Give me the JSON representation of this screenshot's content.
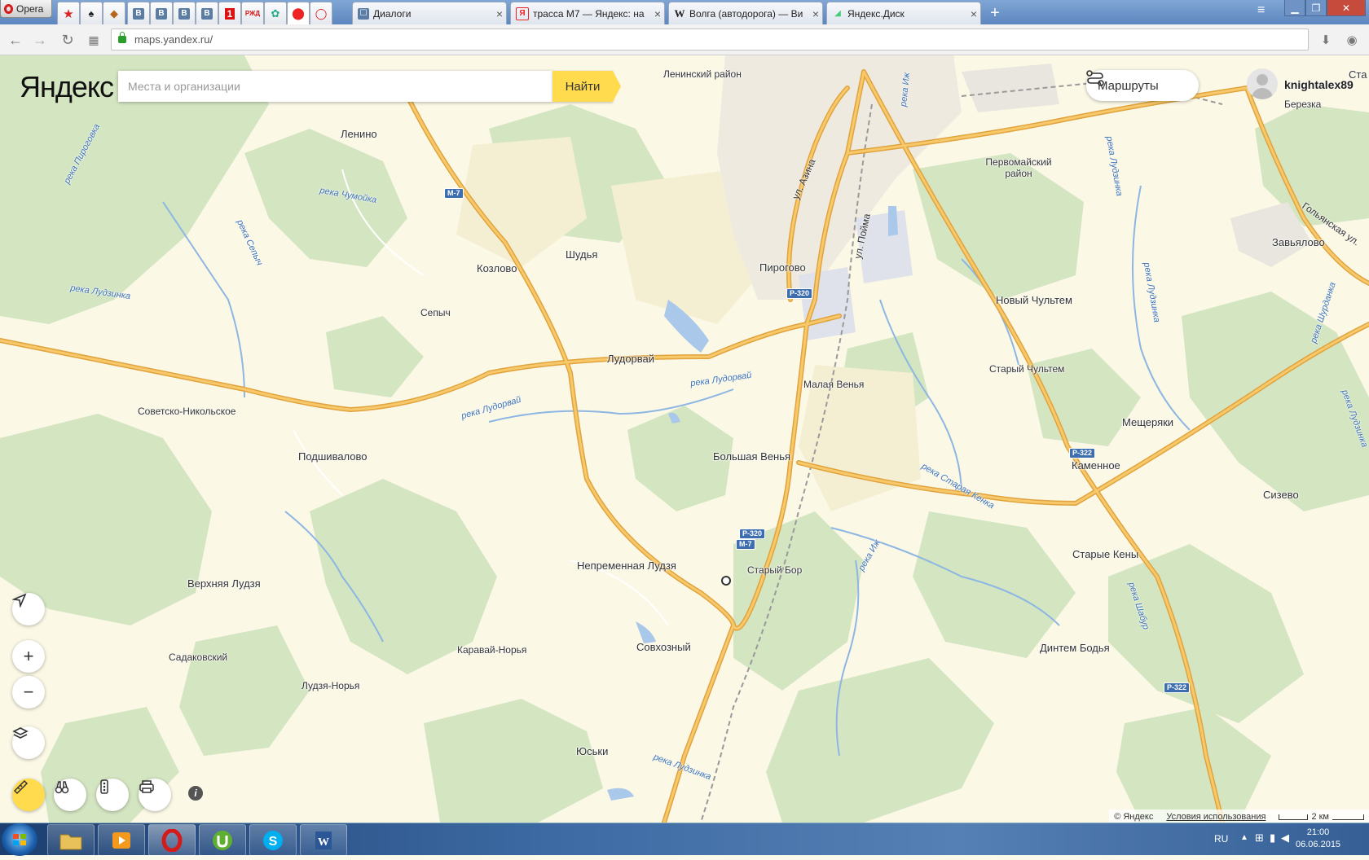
{
  "browser": {
    "app_name": "Opera",
    "tabs": [
      {
        "title": "Диалоги",
        "icon": "chat-icon"
      },
      {
        "title": "трасса М7 — Яндекс: на",
        "icon": "yandex-icon"
      },
      {
        "title": "Волга (автодорога) — Ви",
        "icon": "wikipedia-icon"
      },
      {
        "title": "Яндекс.Диск",
        "icon": "disk-icon"
      }
    ],
    "url": "maps.yandex.ru/"
  },
  "map": {
    "logo": "Яндекс",
    "search_placeholder": "Места и организации",
    "find_button": "Найти",
    "routes_button": "Маршруты",
    "username": "knightalex89",
    "copyright": "© Яндекс",
    "terms": "Условия использования",
    "scale_label": "2 км",
    "places": [
      {
        "name": "Ленинский район"
      },
      {
        "name": "Ленино"
      },
      {
        "name": "Первомайский район"
      },
      {
        "name": "Березка"
      },
      {
        "name": "Шудья"
      },
      {
        "name": "Козлово"
      },
      {
        "name": "Пирогово"
      },
      {
        "name": "Завьялово"
      },
      {
        "name": "Новый Чультем"
      },
      {
        "name": "Сепыч"
      },
      {
        "name": "Лудорвай"
      },
      {
        "name": "Малая Венья"
      },
      {
        "name": "Старый Чультем"
      },
      {
        "name": "Советско-Никольское"
      },
      {
        "name": "Мещеряки"
      },
      {
        "name": "Подшивалово"
      },
      {
        "name": "Большая Венья"
      },
      {
        "name": "Каменное"
      },
      {
        "name": "Сизево"
      },
      {
        "name": "Непременная Лудзя"
      },
      {
        "name": "Старый Бор"
      },
      {
        "name": "Старые Кены"
      },
      {
        "name": "Верхняя Лудзя"
      },
      {
        "name": "Садаковский"
      },
      {
        "name": "Каравай-Норья"
      },
      {
        "name": "Совхозный"
      },
      {
        "name": "Динтем Бодья"
      },
      {
        "name": "Лудзя-Норья"
      },
      {
        "name": "Юськи"
      },
      {
        "name": "Ста"
      }
    ],
    "rivers": [
      {
        "name": "река Пироговка"
      },
      {
        "name": "река Чумойка"
      },
      {
        "name": "река Сепыч"
      },
      {
        "name": "река Лудзинка"
      },
      {
        "name": "река Лудорвай"
      },
      {
        "name": "река Лудорвай"
      },
      {
        "name": "река Старая Кенка"
      },
      {
        "name": "река Иж"
      },
      {
        "name": "река Шабур"
      },
      {
        "name": "река Лудзинка"
      },
      {
        "name": "река Лудзинка"
      },
      {
        "name": "река Лудзинка"
      },
      {
        "name": "река Шурданка"
      },
      {
        "name": "река Лудзинка"
      },
      {
        "name": "река Иж"
      }
    ],
    "streets": [
      {
        "name": "ул. Азина"
      },
      {
        "name": "ул. Пойма"
      },
      {
        "name": "Гольянская ул."
      }
    ],
    "road_shields": [
      {
        "label": "М-7"
      },
      {
        "label": "Р-320"
      },
      {
        "label": "Р-320"
      },
      {
        "label": "М-7"
      },
      {
        "label": "Р-322"
      },
      {
        "label": "Р-322"
      }
    ]
  },
  "taskbar": {
    "language": "RU",
    "time": "21:00",
    "date": "06.06.2015"
  }
}
